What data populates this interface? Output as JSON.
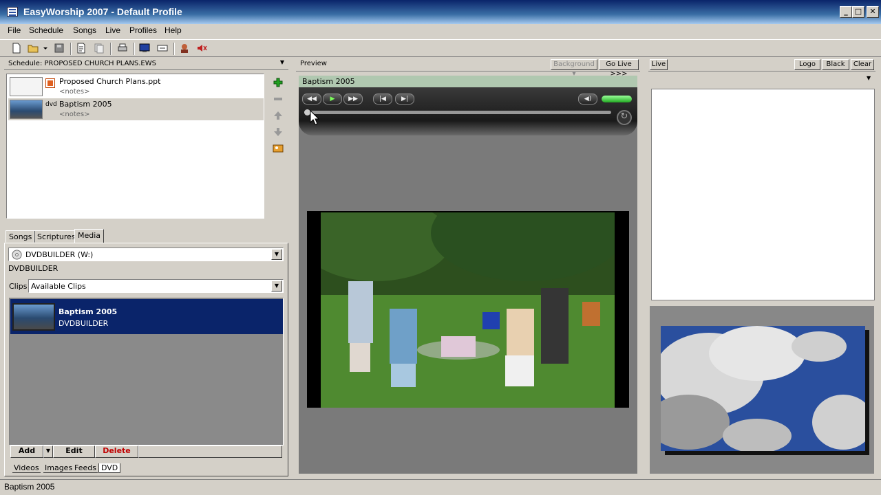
{
  "window": {
    "title": "EasyWorship 2007 - Default Profile",
    "minimize": "_",
    "maximize": "□",
    "close": "✕"
  },
  "menu": [
    "File",
    "Schedule",
    "Songs",
    "Live",
    "Profiles",
    "Help"
  ],
  "schedule": {
    "header": "Schedule: PROPOSED CHURCH PLANS.EWS",
    "items": [
      {
        "name": "Proposed Church Plans.ppt",
        "notes": "<notes>",
        "type_label": ""
      },
      {
        "name": "Baptism 2005",
        "notes": "<notes>",
        "type_label": "dvd"
      }
    ]
  },
  "library": {
    "tabs": [
      "Songs",
      "Scriptures",
      "Media"
    ],
    "active_tab": "Media",
    "drive": "DVDBUILDER (W:)",
    "drive_label": "DVDBUILDER",
    "clips_label": "Clips",
    "clips_value": "Available Clips",
    "selected_clip": {
      "title": "Baptism 2005",
      "subtitle": "DVDBUILDER"
    },
    "buttons": {
      "add": "Add",
      "edit": "Edit",
      "delete": "Delete"
    },
    "bottom_tabs": [
      "Videos",
      "Images",
      "Feeds",
      "DVD"
    ],
    "active_bottom_tab": "DVD"
  },
  "preview": {
    "header": "Preview",
    "background_btn": "Background",
    "golive_btn": "Go Live >>>",
    "item_title": "Baptism 2005",
    "playback_progress": 0.0
  },
  "live": {
    "header": "Live",
    "logo_btn": "Logo",
    "black_btn": "Black",
    "clear_btn": "Clear"
  },
  "status": {
    "text": "Baptism 2005"
  },
  "colors": {
    "selection": "#0a246a",
    "title_start": "#0a246a",
    "delete_text": "#c00000"
  }
}
